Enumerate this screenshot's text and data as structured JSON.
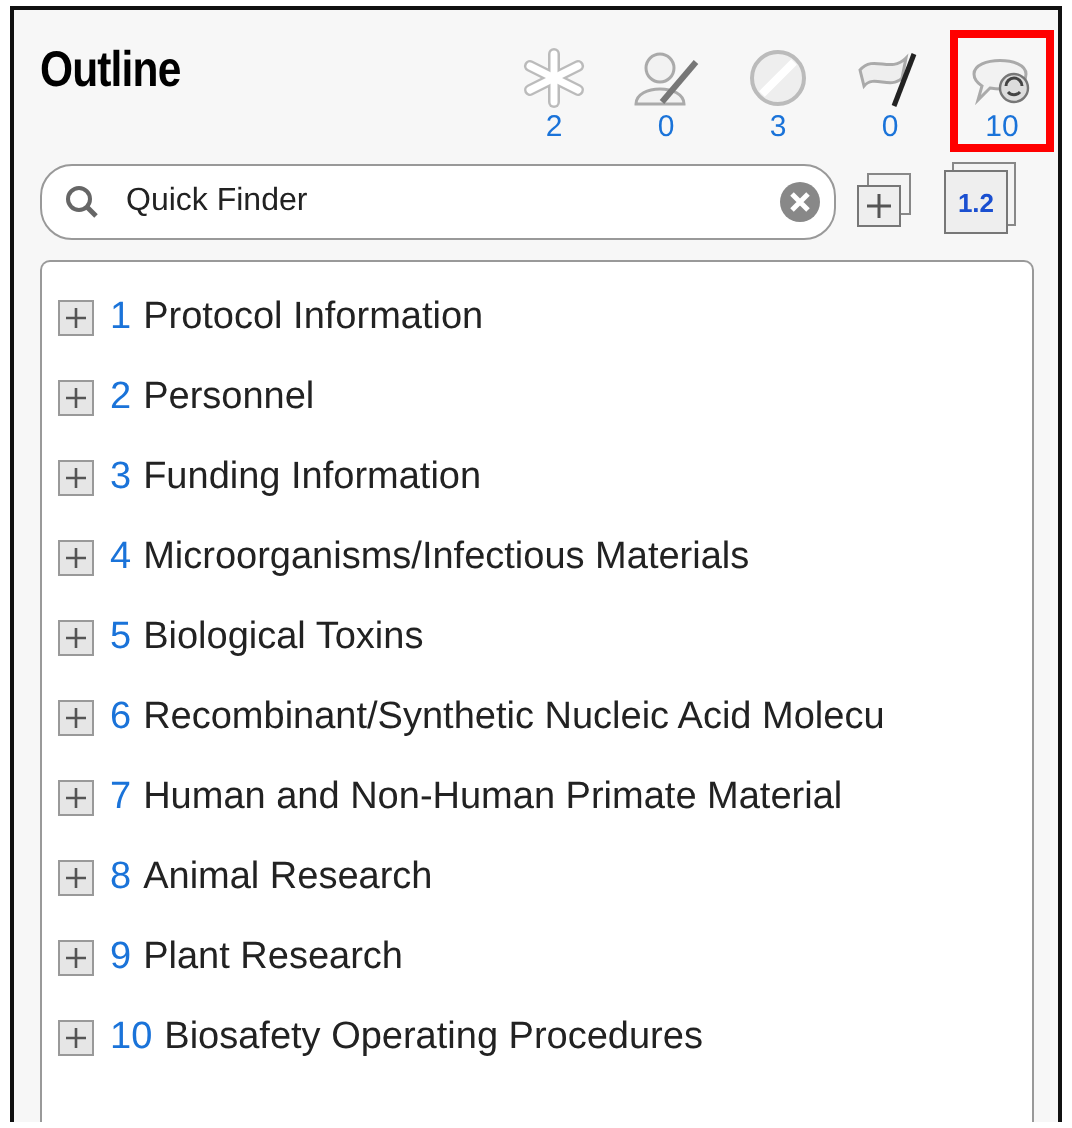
{
  "title": "Outline",
  "filters": [
    {
      "kind": "asterisk",
      "count": "2",
      "highlighted": false
    },
    {
      "kind": "person",
      "count": "0",
      "highlighted": false
    },
    {
      "kind": "blocked",
      "count": "3",
      "highlighted": false
    },
    {
      "kind": "flag",
      "count": "0",
      "highlighted": false
    },
    {
      "kind": "comment",
      "count": "10",
      "highlighted": true
    }
  ],
  "search": {
    "placeholder": "Quick Finder"
  },
  "tools": [
    {
      "kind": "expand"
    },
    {
      "kind": "numbering",
      "label": "1.2"
    }
  ],
  "outline": [
    {
      "number": "1",
      "label": "Protocol Information",
      "expanded": false
    },
    {
      "number": "2",
      "label": "Personnel",
      "expanded": false
    },
    {
      "number": "3",
      "label": "Funding Information",
      "expanded": false
    },
    {
      "number": "4",
      "label": "Microorganisms/Infectious Materials",
      "expanded": false
    },
    {
      "number": "5",
      "label": "Biological Toxins",
      "expanded": false
    },
    {
      "number": "6",
      "label": "Recombinant/Synthetic Nucleic Acid Molecu",
      "expanded": false
    },
    {
      "number": "7",
      "label": "Human and Non-Human Primate Material",
      "expanded": false
    },
    {
      "number": "8",
      "label": "Animal Research",
      "expanded": false
    },
    {
      "number": "9",
      "label": "Plant Research",
      "expanded": false
    },
    {
      "number": "10",
      "label": "Biosafety Operating Procedures",
      "expanded": false
    }
  ]
}
